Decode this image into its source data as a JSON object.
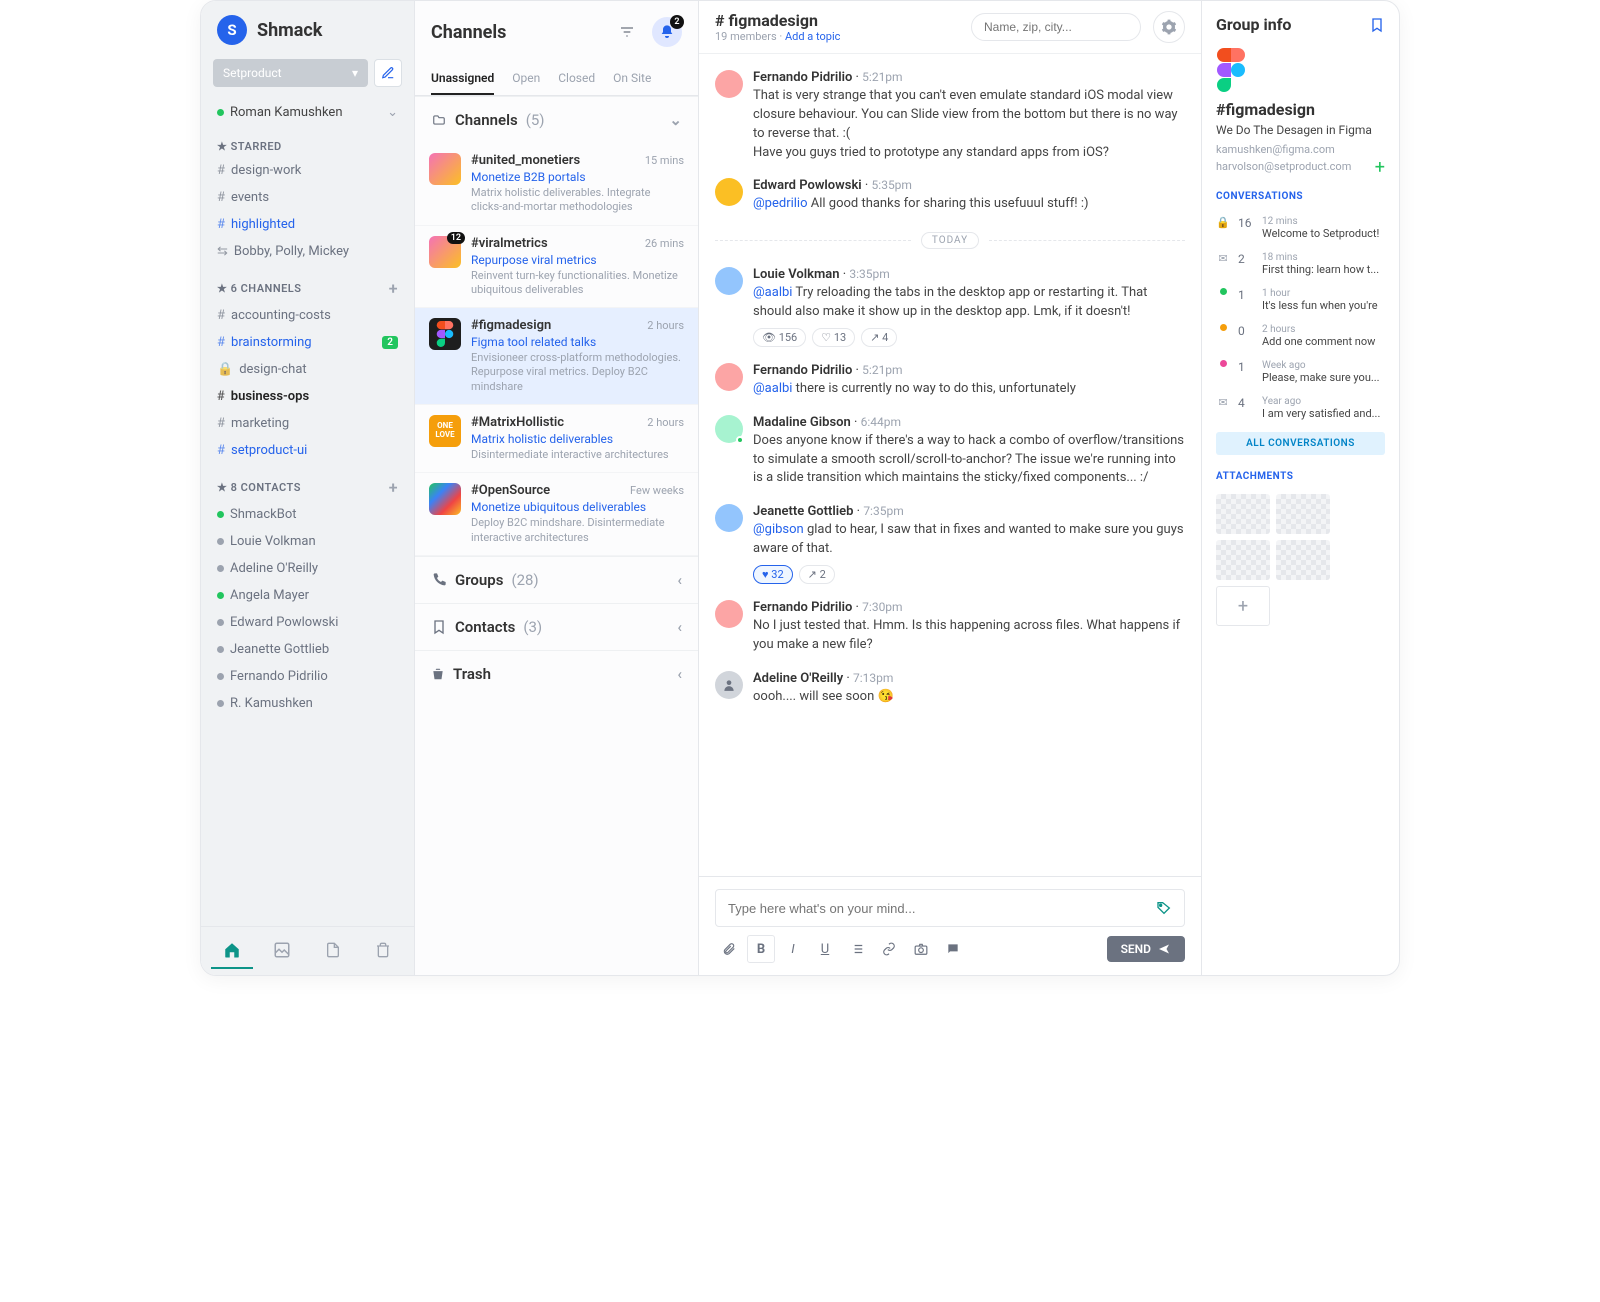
{
  "brand": {
    "initial": "S",
    "name": "Shmack"
  },
  "workspace": {
    "name": "Setproduct"
  },
  "currentUser": {
    "name": "Roman Kamushken"
  },
  "sidebar": {
    "starred": {
      "label": "★ STARRED",
      "items": [
        {
          "pre": "#",
          "label": "design-work"
        },
        {
          "pre": "#",
          "label": "events"
        },
        {
          "pre": "#",
          "label": "highlighted",
          "blue": true
        },
        {
          "pre": "⇆",
          "label": "Bobby, Polly, Mickey"
        }
      ]
    },
    "channels": {
      "label": "★ 6 CHANNELS",
      "items": [
        {
          "pre": "#",
          "label": "accounting-costs"
        },
        {
          "pre": "#",
          "label": "brainstorming",
          "blue": true,
          "badge": "2"
        },
        {
          "pre": "🔒",
          "label": "design-chat"
        },
        {
          "pre": "#",
          "label": "business-ops",
          "bold": true
        },
        {
          "pre": "#",
          "label": "marketing"
        },
        {
          "pre": "#",
          "label": "setproduct-ui",
          "blue": true
        }
      ]
    },
    "contacts": {
      "label": "★ 8 CONTACTS",
      "items": [
        {
          "presence": "green",
          "label": "ShmackBot"
        },
        {
          "presence": "gray",
          "label": "Louie Volkman"
        },
        {
          "presence": "gray",
          "label": "Adeline O'Reilly"
        },
        {
          "presence": "green",
          "label": "Angela Mayer"
        },
        {
          "presence": "gray",
          "label": "Edward Powlowski"
        },
        {
          "presence": "gray",
          "label": "Jeanette Gottlieb"
        },
        {
          "presence": "gray",
          "label": "Fernando Pidrilio"
        },
        {
          "presence": "gray",
          "label": "R. Kamushken"
        }
      ]
    }
  },
  "channelsCol": {
    "title": "Channels",
    "bellCount": "2",
    "tabs": [
      "Unassigned",
      "Open",
      "Closed",
      "On Site"
    ],
    "activeTab": 0,
    "sections": {
      "channels": {
        "label": "Channels",
        "count": "(5)"
      },
      "groups": {
        "label": "Groups",
        "count": "(28)"
      },
      "contacts": {
        "label": "Contacts",
        "count": "(3)"
      },
      "trash": {
        "label": "Trash"
      }
    },
    "items": [
      {
        "name": "#united_monetiers",
        "time": "15 mins",
        "sub": "Monetize B2B portals",
        "desc": "Matrix holistic deliverables. Integrate clicks-and-mortar methodologies",
        "avatar": "c1"
      },
      {
        "name": "#viralmetrics",
        "time": "26 mins",
        "sub": "Repurpose viral metrics",
        "desc": "Reinvent turn-key functionalities. Monetize ubiquitous deliverables",
        "badge": "12",
        "avatar": "c3"
      },
      {
        "name": "#figmadesign",
        "time": "2 hours",
        "sub": "Figma tool related talks",
        "desc": "Envisioneer cross-platform methodologies. Repurpose viral metrics. Deploy B2C mindshare",
        "avatar": "figma",
        "selected": true
      },
      {
        "name": "#MatrixHollistic",
        "time": "2 hours",
        "sub": "Matrix holistic deliverables",
        "desc": "Disintermediate interactive architectures",
        "avatar": "love"
      },
      {
        "name": "#OpenSource",
        "time": "Few weeks",
        "sub": "Monetize ubiquitous deliverables",
        "desc": "Deploy B2C mindshare. Disintermediate interactive architectures",
        "avatar": "rainbow"
      }
    ]
  },
  "chat": {
    "title": "# figmadesign",
    "members": "19 members",
    "addTopic": "Add a topic",
    "searchPlaceholder": "Name, zip, city...",
    "divider": "TODAY",
    "messages": [
      {
        "name": "Fernando Pidrilio",
        "time": "5:21pm",
        "avatar": "c1",
        "text": "That is very strange that you can't even emulate standard iOS modal view closure behaviour. You can Slide view from the bottom but there is no way to reverse that. :(\nHave you guys tried to prototype any standard apps from iOS?"
      },
      {
        "name": "Edward Powlowski",
        "time": "5:35pm",
        "avatar": "c3",
        "mention": "@pedrilio",
        "text": " All good thanks for sharing this usefuuul stuff! :)"
      },
      {
        "divider": true
      },
      {
        "name": "Louie Volkman",
        "time": "3:35pm",
        "avatar": "c2",
        "mention": "@aalbi",
        "text": " Try reloading the tabs in the desktop app or restarting it. That should also make it show up in the desktop app. Lmk, if it doesn't!",
        "reactions": [
          {
            "icon": "👁",
            "count": "156"
          },
          {
            "icon": "♡",
            "count": "13"
          },
          {
            "icon": "↗",
            "count": "4"
          }
        ]
      },
      {
        "name": "Fernando Pidrilio",
        "time": "5:21pm",
        "avatar": "c1",
        "mention": "@aalbi",
        "text": " there is currently no way to do this, unfortunately"
      },
      {
        "name": "Madaline Gibson",
        "time": "6:44pm",
        "avatar": "c4",
        "online": true,
        "text": "Does anyone know if there's a way to hack a combo of overflow/transitions to simulate a smooth scroll/scroll-to-anchor? The issue we're running into is a slide transition which maintains the sticky/fixed components... :/"
      },
      {
        "name": "Jeanette Gottlieb",
        "time": "7:35pm",
        "avatar": "c2",
        "mention": "@gibson",
        "text": " glad to hear, I saw that in fixes and wanted to make sure you guys aware of that.",
        "reactions": [
          {
            "icon": "♥",
            "count": "32",
            "active": true
          },
          {
            "icon": "↗",
            "count": "2"
          }
        ]
      },
      {
        "name": "Fernando Pidrilio",
        "time": "7:30pm",
        "avatar": "c1",
        "text": "No I just tested that. Hmm. Is this happening across files. What happens if you make a new file?"
      },
      {
        "name": "Adeline O'Reilly",
        "time": "7:13pm",
        "avatar": "gray",
        "text": "oooh.... will see soon 😘"
      }
    ],
    "composer": {
      "placeholder": "Type here what's on your mind...",
      "send": "SEND"
    }
  },
  "info": {
    "title": "Group info",
    "name": "#figmadesign",
    "desc": "We Do The Desagen in Figma",
    "emails": [
      "kamushken@figma.com",
      "harvolson@setproduct.com"
    ],
    "convLabel": "CONVERSATIONS",
    "conversations": [
      {
        "icon": "🔒",
        "num": "16",
        "time": "12 mins",
        "text": "Welcome to Setproduct!",
        "dot": ""
      },
      {
        "icon": "✉",
        "num": "2",
        "time": "18 mins",
        "text": "First thing: learn how t...",
        "dot": ""
      },
      {
        "icon": "",
        "num": "1",
        "time": "1 hour",
        "text": "It's less fun when you're",
        "dot": "green"
      },
      {
        "icon": "",
        "num": "0",
        "time": "2 hours",
        "text": "Add one comment now",
        "dot": "orange"
      },
      {
        "icon": "",
        "num": "1",
        "time": "Week ago",
        "text": "Please, make sure you...",
        "dot": "pink"
      },
      {
        "icon": "✉",
        "num": "4",
        "time": "Year ago",
        "text": "I am very satisfied and...",
        "dot": ""
      }
    ],
    "allConv": "ALL CONVERSATIONS",
    "attachLabel": "ATTACHMENTS"
  }
}
